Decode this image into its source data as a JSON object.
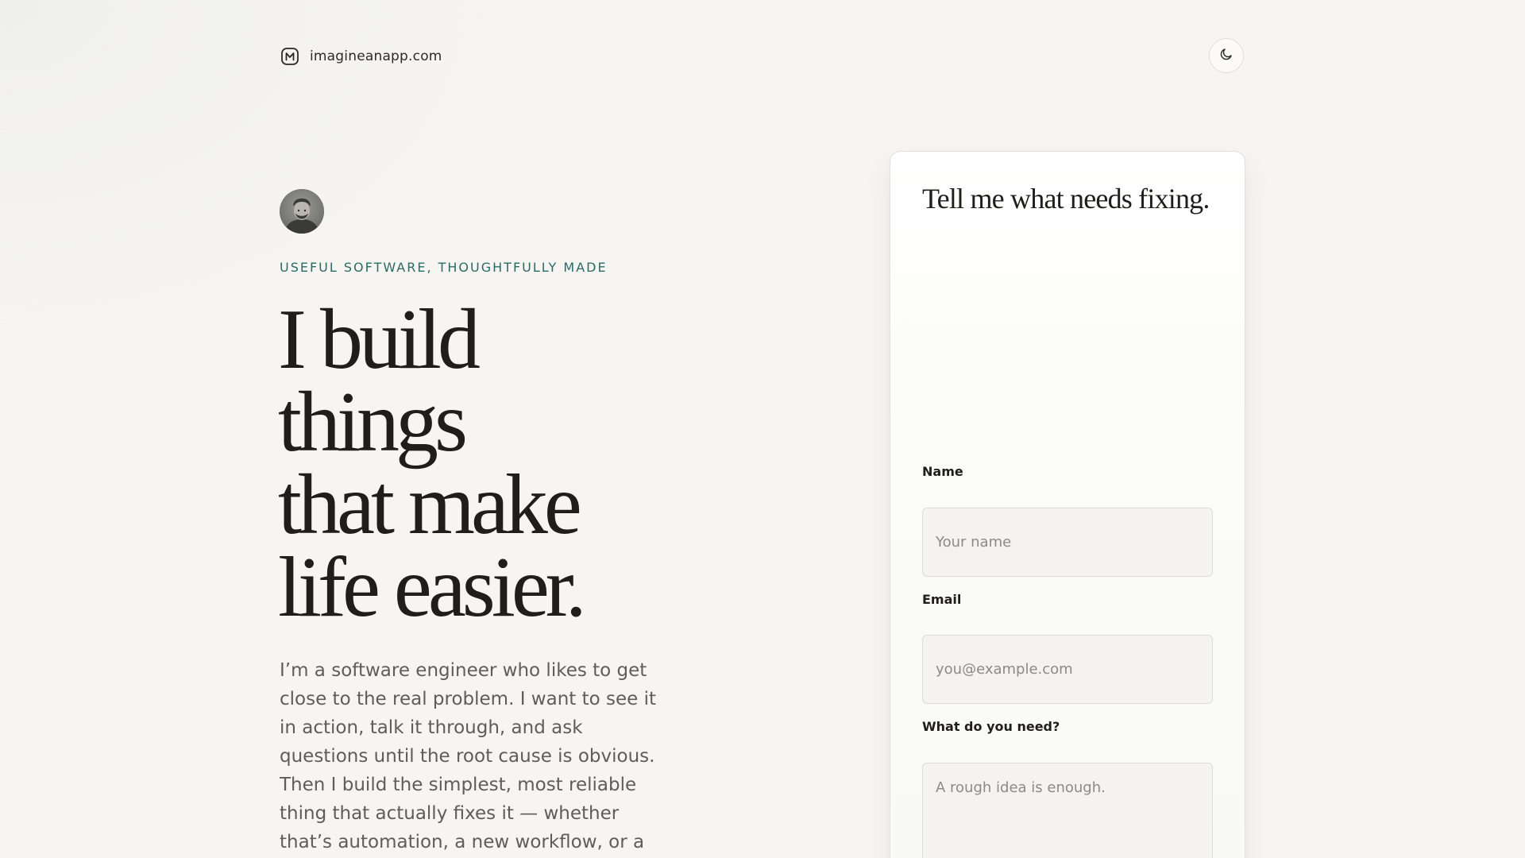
{
  "header": {
    "brand_icon": "logo-m-icon",
    "brand_text": "imagineanapp.com",
    "theme_toggle_icon": "moon-icon"
  },
  "hero": {
    "avatar": "profile-avatar",
    "eyebrow": "USEFUL SOFTWARE, THOUGHTFULLY MADE",
    "headline_lines": [
      "I build",
      "things",
      "that make",
      "life easier."
    ],
    "intro": "I’m a software engineer who likes to get close to the real problem. I want to see it in action, talk it through, and ask questions until the root cause is obvious. Then I build the simplest, most reliable thing that actually fixes it — whether that’s automation, a new workflow, or a"
  },
  "contact_form": {
    "title": "Tell me what needs fixing.",
    "name_label": "Name",
    "name_placeholder": "Your name",
    "email_label": "Email",
    "email_placeholder": "you@example.com",
    "need_label": "What do you need?",
    "need_placeholder": "A rough idea is enough."
  },
  "colors": {
    "background": "#f6f5f2",
    "accent": "#2a6a66",
    "text": "#1f1e1b",
    "muted_text": "#5f5d58"
  }
}
